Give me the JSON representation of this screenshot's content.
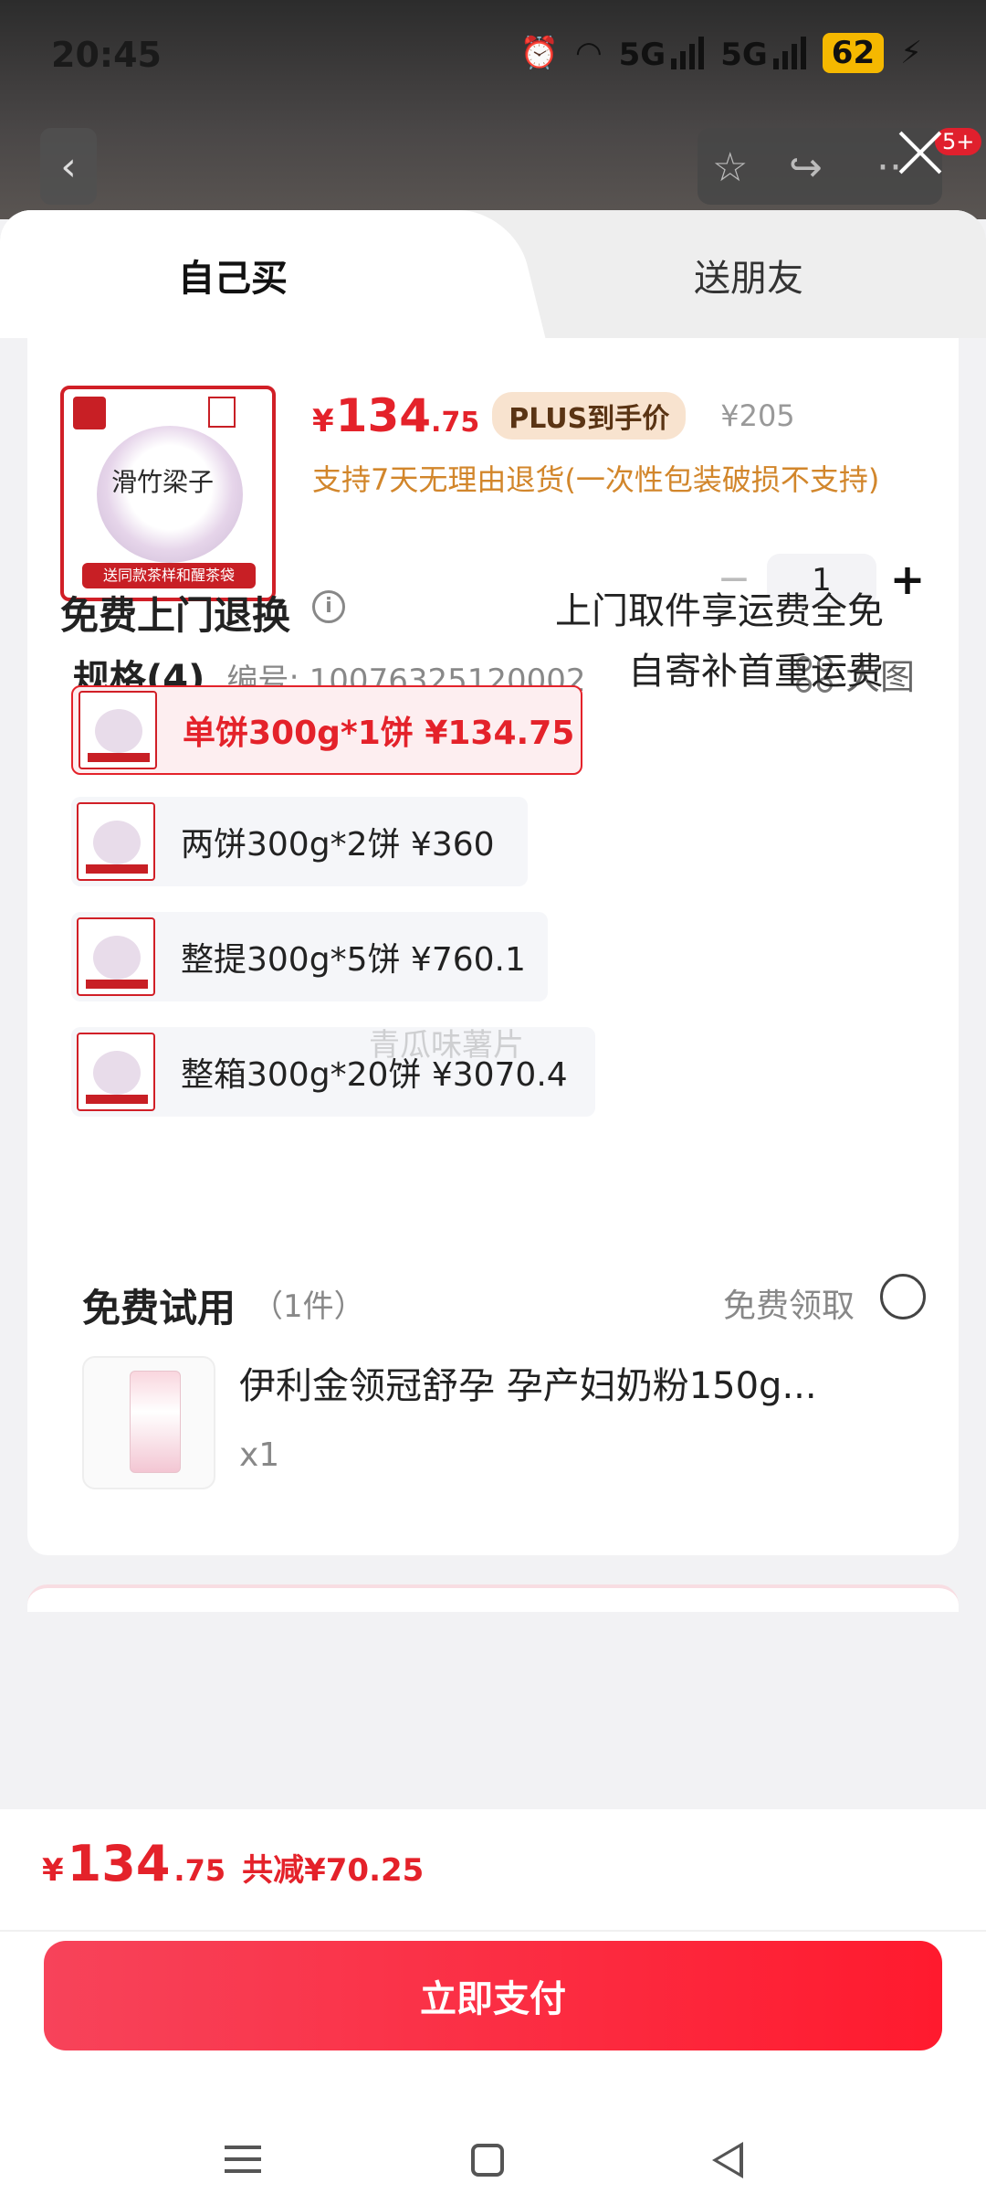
{
  "status_bar": {
    "time": "20:45",
    "battery": "62",
    "network_labels": [
      "5G",
      "5G"
    ]
  },
  "overlay": {
    "badge_count": "5+"
  },
  "tabs": {
    "self_buy": "自己买",
    "gift": "送朋友",
    "active": "自己买"
  },
  "product": {
    "image_title": "滑竹梁子",
    "image_banner": "送同款茶样和醒茶袋",
    "price_symbol": "¥",
    "price_int": "134",
    "price_dec": ".75",
    "plus_label": "PLUS到手价",
    "original_price": "¥205",
    "return_policy": "支持7天无理由退货(一次性包装破损不支持)",
    "quantity": "1",
    "minus_symbol": "−",
    "plus_symbol": "+"
  },
  "spec": {
    "title": "规格(4)",
    "code": "编号: 10076325120002",
    "big_image_label": "大图",
    "options": [
      {
        "label": "单饼300g*1饼  ¥134.75",
        "selected": true
      },
      {
        "label": "两饼300g*2饼  ¥360",
        "selected": false
      },
      {
        "label": "整提300g*5饼  ¥760.1",
        "selected": false
      },
      {
        "label": "整箱300g*20饼  ¥3070.4",
        "selected": false
      }
    ]
  },
  "watermark": "青瓜味薯片",
  "refund": {
    "title": "免费上门退换",
    "info_symbol": "i",
    "line1": "上门取件享运费全免",
    "line2": "自寄补首重运费"
  },
  "trial": {
    "title": "免费试用",
    "count": "（1件）",
    "get_label": "免费领取",
    "item_name": "伊利金领冠舒孕 孕产妇奶粉150g...",
    "item_qty": "x1"
  },
  "footer": {
    "total_symbol": "¥",
    "total_int": "134",
    "total_dec": ".75",
    "discount": "共减¥70.25",
    "pay_label": "立即支付"
  },
  "colors": {
    "accent_red": "#e4222a",
    "return_note_orange": "#d2862b",
    "plus_badge_bg": "#f8e3cf"
  },
  "icons": [
    "back-icon",
    "star-icon",
    "share-icon",
    "more-icon",
    "close-icon",
    "info-icon",
    "grid-icon",
    "radio-icon",
    "menu-icon",
    "home-icon",
    "nav-back-icon"
  ]
}
